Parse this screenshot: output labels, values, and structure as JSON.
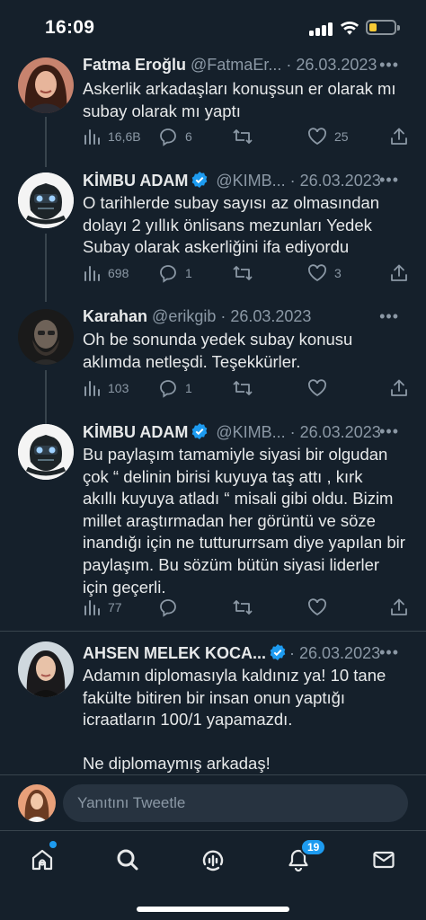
{
  "status_bar": {
    "time": "16:09"
  },
  "tweets": [
    {
      "name": "Fatma Eroğlu",
      "handle": "@FatmaEr...",
      "date": "26.03.2023",
      "verified": false,
      "text_lines": [
        "Askerlik arkadaşları konuşsun er olarak mı",
        "subay olarak mı yaptı"
      ],
      "views": "16,6B",
      "replies": "6",
      "retweets": "",
      "likes": "25"
    },
    {
      "name": "KİMBU ADAM",
      "handle": "@KIMB...",
      "date": "26.03.2023",
      "verified": true,
      "text_lines": [
        "O tarihlerde subay sayısı az olmasından",
        "dolayı 2 yıllık önlisans mezunları Yedek",
        "Subay olarak askerliğini ifa ediyordu"
      ],
      "views": "698",
      "replies": "1",
      "retweets": "",
      "likes": "3"
    },
    {
      "name": "Karahan",
      "handle": "@erikgib",
      "date": "26.03.2023",
      "verified": false,
      "text_lines": [
        "Oh be sonunda yedek subay konusu",
        "aklımda netleşdi. Teşekkürler."
      ],
      "views": "103",
      "replies": "1",
      "retweets": "",
      "likes": ""
    },
    {
      "name": "KİMBU ADAM",
      "handle": "@KIMB...",
      "date": "26.03.2023",
      "verified": true,
      "text_lines": [
        "Bu paylaşım tamamiyle siyasi bir olgudan",
        "çok “ delinin birisi kuyuya taş attı , kırk",
        "akıllı kuyuya atladı “ misali gibi oldu. Bizim",
        "millet araştırmadan her görüntü ve söze",
        "inandığı için ne tuttururrsam diye yapılan bir",
        "paylaşım. Bu sözüm bütün siyasi liderler",
        "için geçerli."
      ],
      "views": "77",
      "replies": "",
      "retweets": "",
      "likes": ""
    },
    {
      "name": "AHSEN MELEK KOCA...",
      "handle": "",
      "date": "26.03.2023",
      "verified": true,
      "text_lines": [
        "Adamın diplomasıyla kaldınız ya! 10 tane",
        "fakülte bitiren bir insan onun yaptığı",
        "icraatların 100/1 yapamazdı.",
        "",
        "Ne diplomaymış arkadaş!"
      ]
    }
  ],
  "reply_bar": {
    "placeholder": "Yanıtını Tweetle"
  },
  "tab_bar": {
    "items": [
      {
        "name": "home",
        "icon": "home-icon"
      },
      {
        "name": "search",
        "icon": "search-icon"
      },
      {
        "name": "spaces",
        "icon": "spaces-icon"
      },
      {
        "name": "notifications",
        "icon": "bell-icon",
        "badge": "19"
      },
      {
        "name": "messages",
        "icon": "mail-icon"
      }
    ]
  },
  "colors": {
    "background": "#15202b",
    "text": "#e7e9ea",
    "muted": "#8b98a5",
    "accent": "#1d9bf0",
    "divider": "#38444d"
  }
}
